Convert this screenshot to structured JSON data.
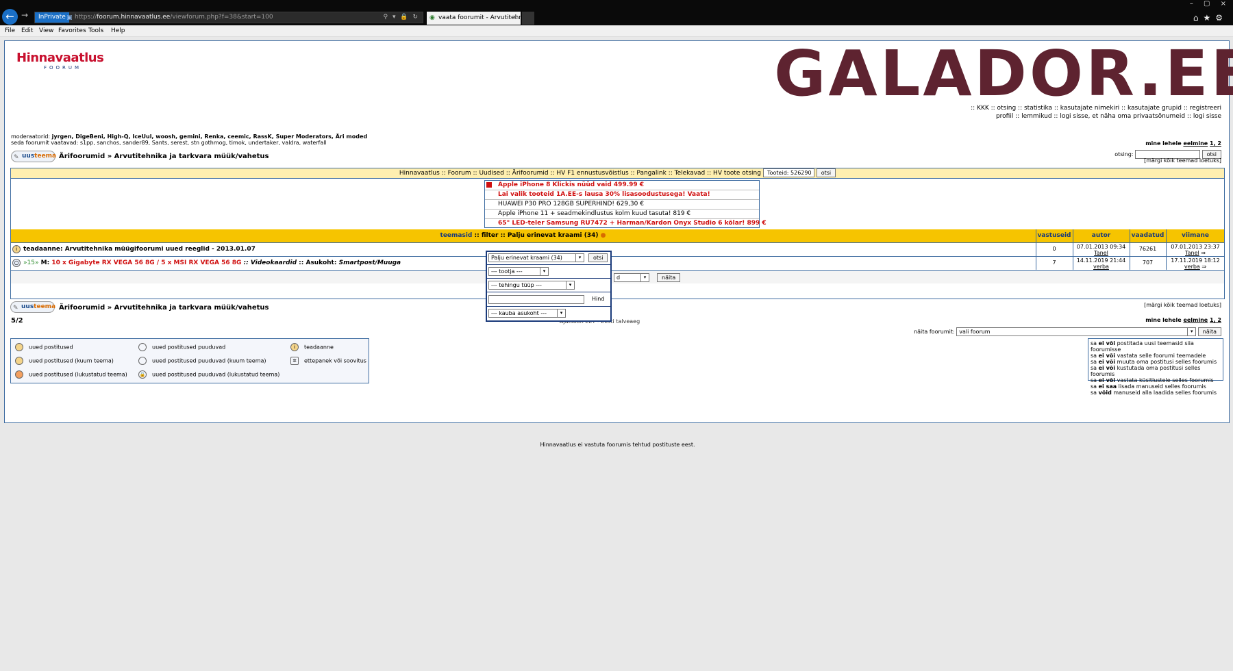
{
  "browser": {
    "inprivate": "InPrivate",
    "url_prefix": "https://",
    "url_domain": "foorum.hinnavaatlus.ee",
    "url_rest": "/viewforum.php?f=38&start=100",
    "tab_title": "vaata foorumit - Arvutitehn...",
    "menu": [
      "File",
      "Edit",
      "View",
      "Favorites",
      "Tools",
      "Help"
    ]
  },
  "logo": {
    "main": "Hinnavaatlus",
    "sub": "FOORUM"
  },
  "banner": "GALADOR.EE",
  "links": {
    "line1": ":: KKK  :: otsing  :: statistika  :: kasutajate nimekiri  :: kasutajate grupid  :: registreeri",
    "line2": "profiil  :: lemmikud  :: logi sisse, et näha oma privaatsõnumeid  :: logi sisse"
  },
  "moderators_label": "moderaatorid:",
  "moderators": "jyrgen, DigeBeni, High-Q, IceUul, woosh, gemini, Renka, ceemic, RassK, Super Moderators, Äri moded",
  "viewers_label": "seda foorumit vaatavad:",
  "viewers": "s1pp, sanchos, sander89, Sants, serest, stn gothmog, timok, undertaker, valdra, waterfall",
  "nextpage_label": "mine lehele",
  "prev_link": "eelmine",
  "pages": "1, 2",
  "search_label": "otsing:",
  "search_btn": "otsi",
  "markread": "[märgi kõik teemad loetuks]",
  "newtopic": {
    "a": "uus",
    "b": "teema"
  },
  "breadcrumb": "Ärifoorumid » Arvutitehnika ja tarkvara müük/vahetus",
  "navbar": "Hinnavaatlus :: Foorum :: Uudised :: Ärifoorumid :: HV F1 ennustusvõistlus :: Pangalink :: Telekavad :: HV toote otsing",
  "product_count": "Tooteid: 526290",
  "ads": [
    {
      "text": "Apple iPhone 8 Klickis nüüd vaid 499.99 €",
      "red": true
    },
    {
      "text": "Lai valik tooteid 1A.EE-s lausa 30% lisasoodustusega! Vaata!",
      "red": true
    },
    {
      "text": "HUAWEI P30 PRO 128GB SUPERHIND! 629,30 €",
      "red": false
    },
    {
      "text": "Apple iPhone 11 + seadmekindlustus kolm kuud tasuta! 819 €",
      "red": false
    },
    {
      "text": "65\" LED-teler Samsung RU7472 + Harman/Kardon Onyx Studio 6 kõlar! 899 €",
      "red": true
    }
  ],
  "table": {
    "col_topics": "teemasid",
    "filter_text": ":: filter :: Palju erinevat kraami (34)",
    "col_replies": "vastuseid",
    "col_author": "autor",
    "col_views": "vaadatud",
    "col_last": "viimane postitus",
    "rows": [
      {
        "title": "teadaanne: Arvutitehnika müügifoorumi uued reeglid - 2013.01.07",
        "replies": "0",
        "date": "07.01.2013 09:34",
        "author": "Tanel",
        "views": "76261",
        "last_date": "07.01.2013 23:37",
        "last_author": "Tanel"
      },
      {
        "prefix": "»15»",
        "title_m": "M:",
        "title_red": "10 x Gigabyte RX VEGA 56 8G / 5 x MSI RX VEGA 56 8G",
        "category": ":: Videokaardid",
        "loc_label": ":: Asukoht:",
        "location": "Smartpost/Muuga",
        "replies": "7",
        "date": "14.11.2019 21:44",
        "author": "verba",
        "views": "707",
        "last_date": "17.11.2019 18:12",
        "last_author": "verba"
      }
    ],
    "show_btn": "näita"
  },
  "filter_panel": {
    "category": "Palju erinevat kraami (34)",
    "search_btn": "otsi",
    "maker": "--- tootja ---",
    "deal_type": "--- tehingu tüüp ---",
    "price_btn": "Hind",
    "location": "--- kauba asukoht ---"
  },
  "pagecount": "5/2",
  "timezone": "Ajatsoon EET - Eesti talveaeg",
  "showforum_label": "näita foorumit:",
  "showforum_value": "vali foorum",
  "legend": [
    "uued postitused",
    "uued postitused puuduvad",
    "teadaanne",
    "uued postitused (kuum teema)",
    "uued postitused puuduvad (kuum teema)",
    "ettepanek või soovitus",
    "uued postitused (lukustatud teema)",
    "uued postitused puuduvad (lukustatud teema)"
  ],
  "perms": [
    [
      "sa ",
      "ei või",
      " postitada uusi teemasid siia foorumisse"
    ],
    [
      "sa ",
      "ei või",
      " vastata selle foorumi teemadele"
    ],
    [
      "sa ",
      "ei või",
      " muuta oma postitusi selles foorumis"
    ],
    [
      "sa ",
      "ei või",
      " kustutada oma postitusi selles foorumis"
    ],
    [
      "sa ",
      "ei või",
      " vastata küsitlustele selles foorumis"
    ],
    [
      "sa ",
      "ei saa",
      " lisada manuseid selles foorumis"
    ],
    [
      "sa ",
      "võid",
      " manuseid alla laadida selles foorumis"
    ]
  ],
  "footer": "Hinnavaatlus ei vastuta foorumis tehtud postituste eest."
}
